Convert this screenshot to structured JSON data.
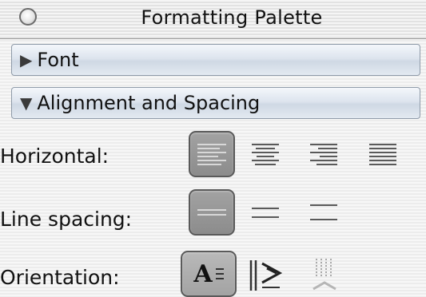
{
  "window": {
    "title": "Formatting Palette"
  },
  "sections": [
    {
      "label": "Font",
      "state": "collapsed"
    },
    {
      "label": "Alignment and Spacing",
      "state": "expanded"
    }
  ],
  "alignment": {
    "horizontal_label": "Horizontal:",
    "horizontal_options": [
      "align-left",
      "align-center",
      "align-right",
      "justify"
    ],
    "horizontal_selected": "align-left",
    "line_spacing_label": "Line spacing:",
    "line_spacing_options": [
      "single",
      "one-and-half",
      "double"
    ],
    "line_spacing_selected": "single",
    "orientation_label": "Orientation:",
    "orientation_options": [
      "horizontal",
      "rotated",
      "vertical"
    ],
    "orientation_selected": "horizontal",
    "orientation_glyph": "A"
  },
  "colors": {
    "section_header": "#d6dee9",
    "selected_button": "#959595",
    "background_stripe": "#ececec"
  }
}
